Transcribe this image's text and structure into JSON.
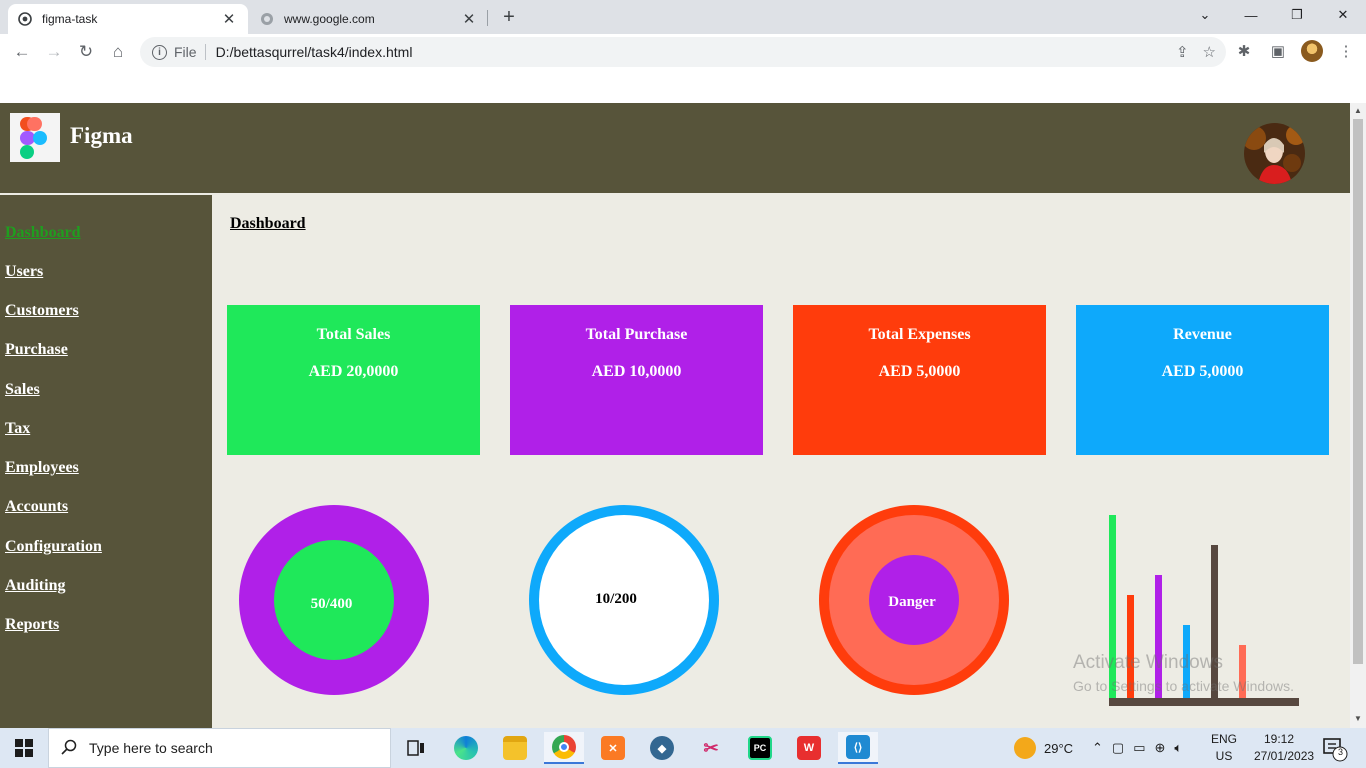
{
  "browser": {
    "tabs": [
      {
        "title": "figma-task",
        "active": true
      },
      {
        "title": "www.google.com",
        "active": false
      }
    ],
    "address": {
      "scheme": "File",
      "url": "D:/bettasqurrel/task4/index.html"
    }
  },
  "app": {
    "brand": "Figma",
    "breadcrumb": "Dashboard",
    "nav": [
      {
        "label": "Dashboard",
        "active": true
      },
      {
        "label": "Users"
      },
      {
        "label": "Customers"
      },
      {
        "label": "Purchase"
      },
      {
        "label": "Sales"
      },
      {
        "label": "Tax"
      },
      {
        "label": "Employees"
      },
      {
        "label": "Accounts"
      },
      {
        "label": "Configuration"
      },
      {
        "label": "Auditing"
      },
      {
        "label": "Reports"
      }
    ],
    "cards": [
      {
        "title": "Total Sales",
        "value": "AED 20,0000",
        "color": "#1fe85a"
      },
      {
        "title": "Total Purchase",
        "value": "AED 10,0000",
        "color": "#b020e8"
      },
      {
        "title": "Total Expenses",
        "value": "AED 5,0000",
        "color": "#ff3c0c"
      },
      {
        "title": "Revenue",
        "value": "AED 5,0000",
        "color": "#0ea9fb"
      }
    ],
    "circles": [
      {
        "label": "50/400",
        "outer": "#b020e8",
        "inner": "#1fe85a"
      },
      {
        "label": "10/200",
        "outer": "#0ea9fb",
        "inner": "#ffffff"
      },
      {
        "label": "Danger",
        "outer": "#ff3c0c",
        "mid": "#ff6b55",
        "inner": "#b020e8"
      }
    ],
    "bar_colors": [
      "#1fe85a",
      "#ff3c0c",
      "#b020e8",
      "#0ea9fb",
      "#57483f",
      "#ff6b55"
    ],
    "watermark": {
      "line1": "Activate Windows",
      "line2": "Go to Settings to activate Windows."
    }
  },
  "taskbar": {
    "search_placeholder": "Type here to search",
    "weather": "29°C",
    "lang": [
      "ENG",
      "US"
    ],
    "time": "19:12",
    "date": "27/01/2023",
    "notifications": "3"
  }
}
